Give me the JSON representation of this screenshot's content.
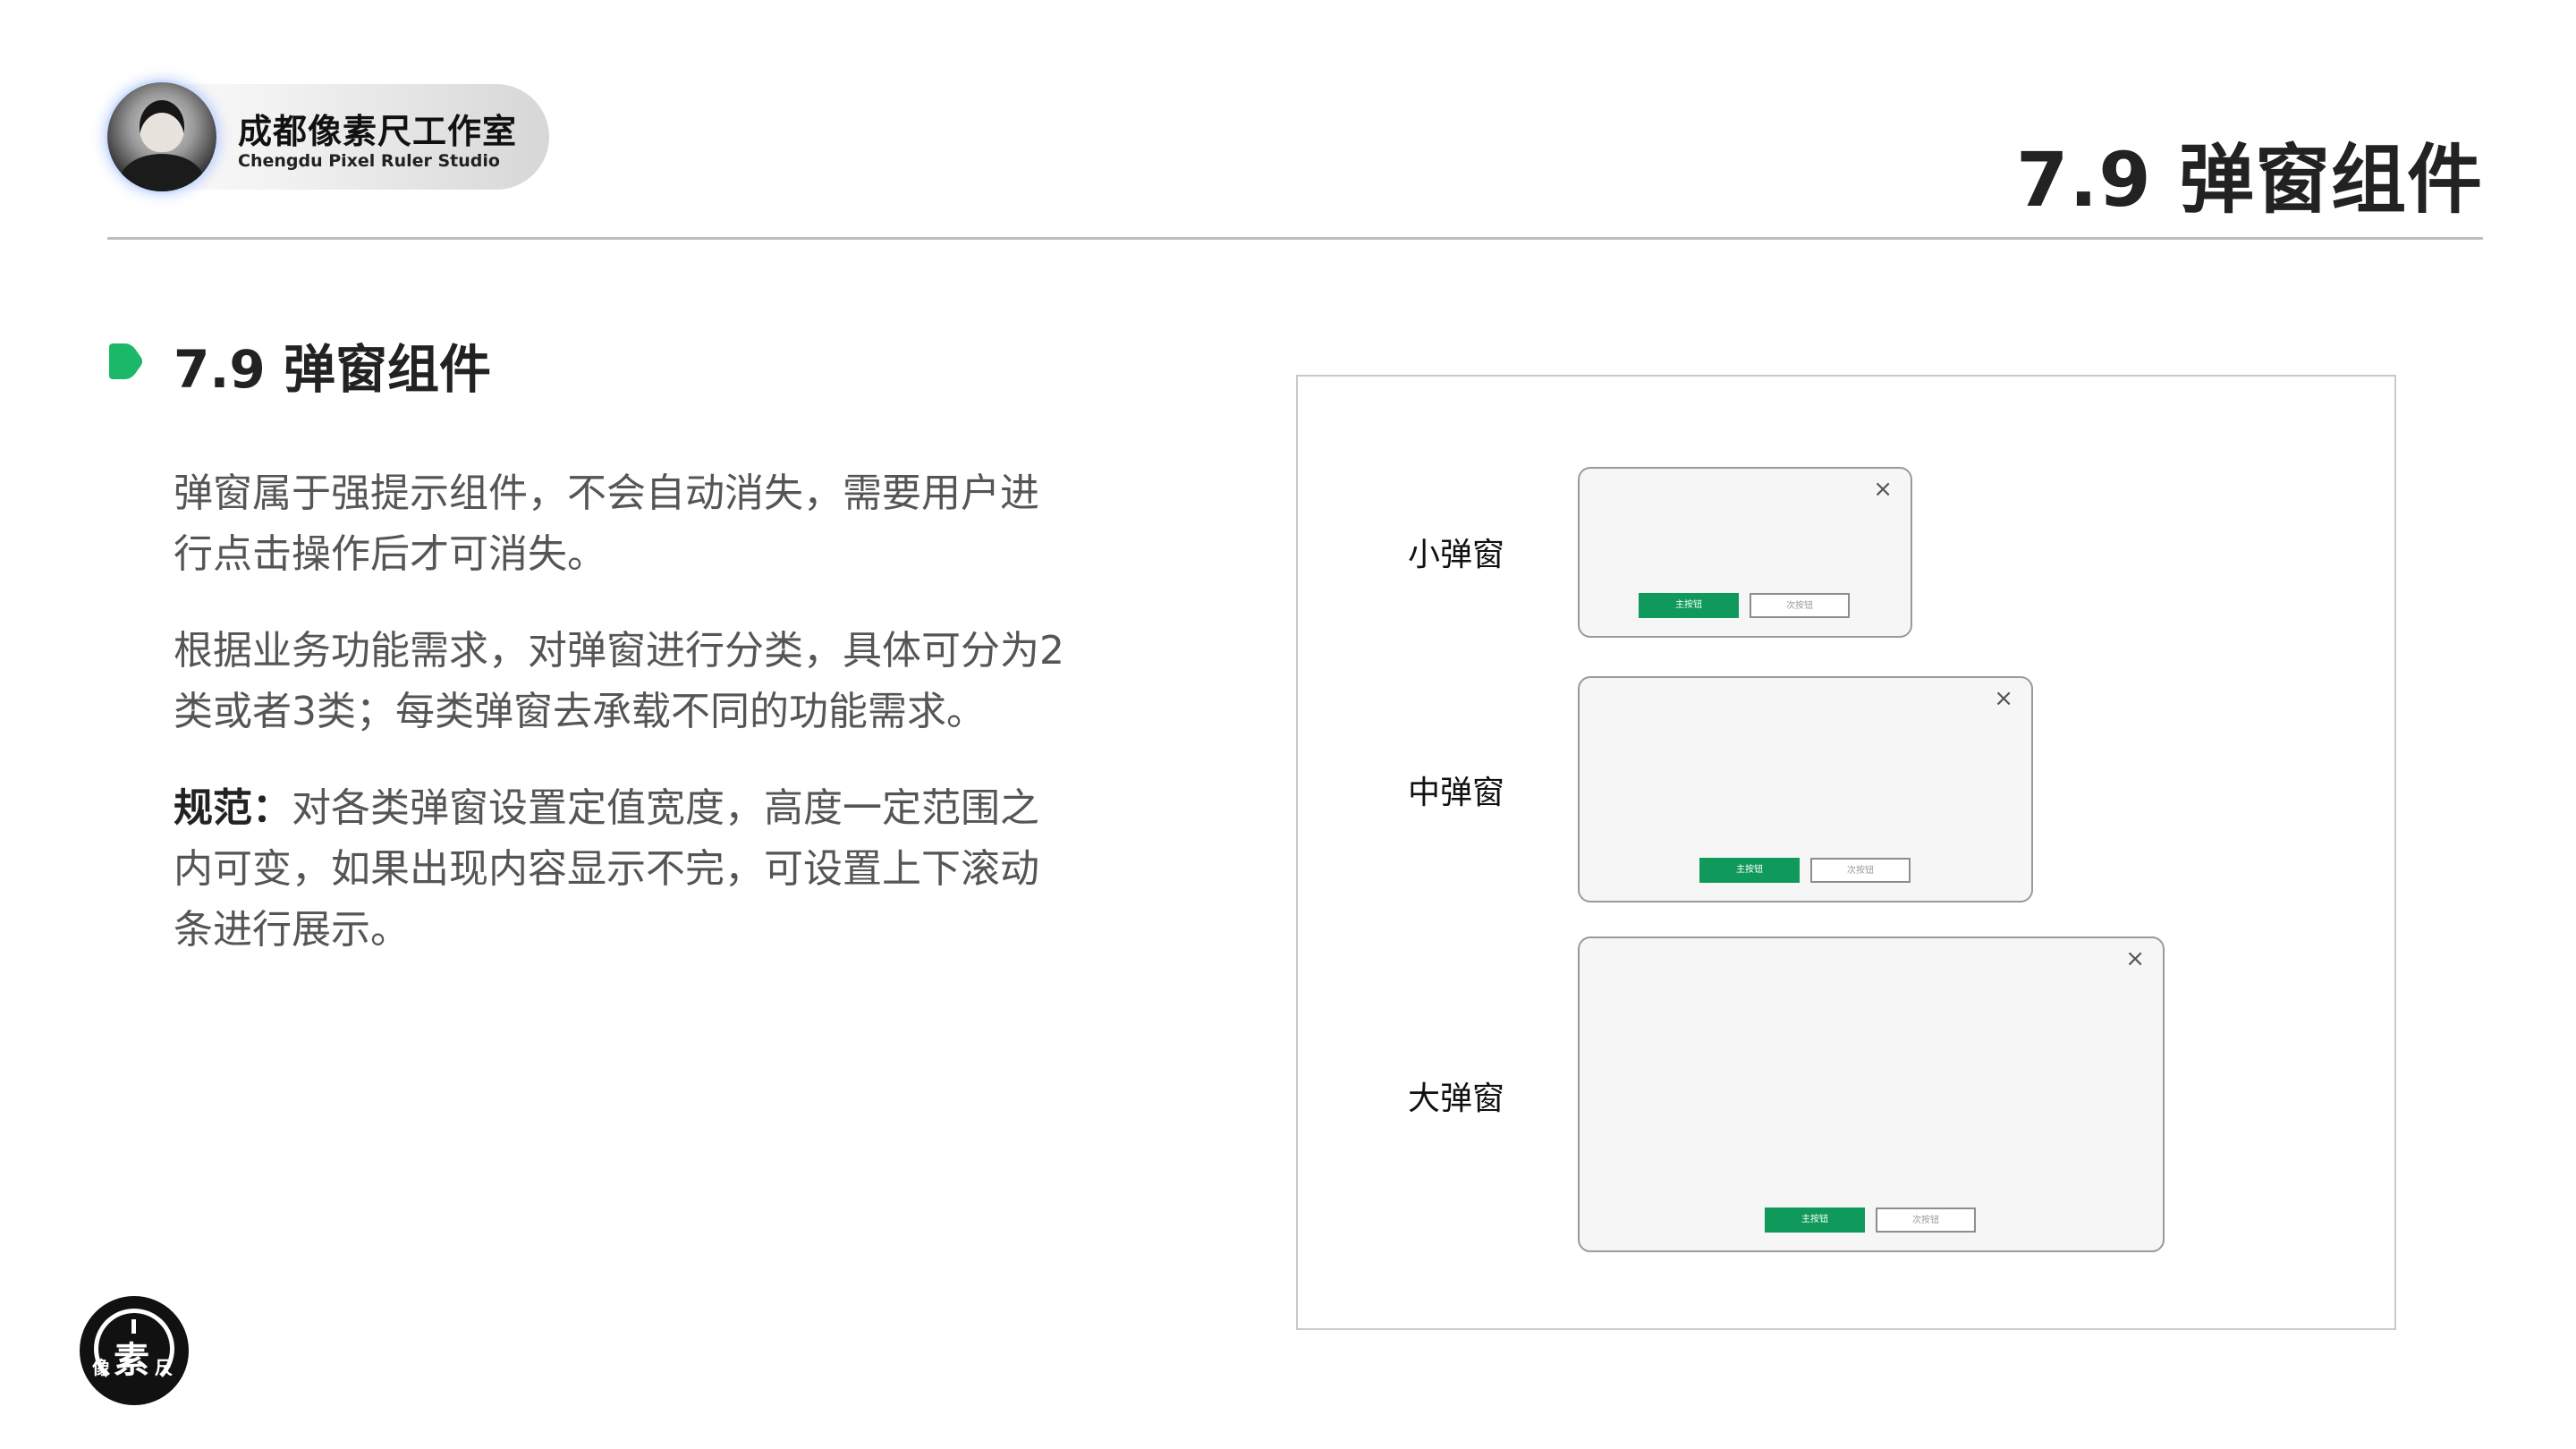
{
  "header": {
    "studio_name": "成都像素尺工作室",
    "studio_name_en": "Chengdu Pixel Ruler Studio",
    "page_title": "7.9 弹窗组件"
  },
  "section": {
    "heading": "7.9 弹窗组件",
    "paragraph_1": "弹窗属于强提示组件，不会自动消失，需要用户进行点击操作后才可消失。",
    "paragraph_2": "根据业务功能需求，对弹窗进行分类，具体可分为2类或者3类；每类弹窗去承载不同的功能需求。",
    "paragraph_3_label": "规范：",
    "paragraph_3_text": "对各类弹窗设置定值宽度，高度一定范围之内可变，如果出现内容显示不完，可设置上下滚动条进行展示。"
  },
  "illustration": {
    "dialogs": [
      {
        "label": "小弹窗",
        "close_symbol": "×",
        "primary_button": "主按钮",
        "secondary_button": "次按钮"
      },
      {
        "label": "中弹窗",
        "close_symbol": "×",
        "primary_button": "主按钮",
        "secondary_button": "次按钮"
      },
      {
        "label": "大弹窗",
        "close_symbol": "×",
        "primary_button": "主按钮",
        "secondary_button": "次按钮"
      }
    ]
  },
  "footer_logo": {
    "main_glyph": "素",
    "left_glyph": "像",
    "right_glyph": "尺"
  },
  "colors": {
    "primary_green": "#0f9a5b",
    "marker_green": "#1cb86a",
    "rule_gray": "#bdbdbd"
  },
  "icons": {
    "section_marker": "play-marker-icon",
    "dialog_close": "close-icon"
  }
}
